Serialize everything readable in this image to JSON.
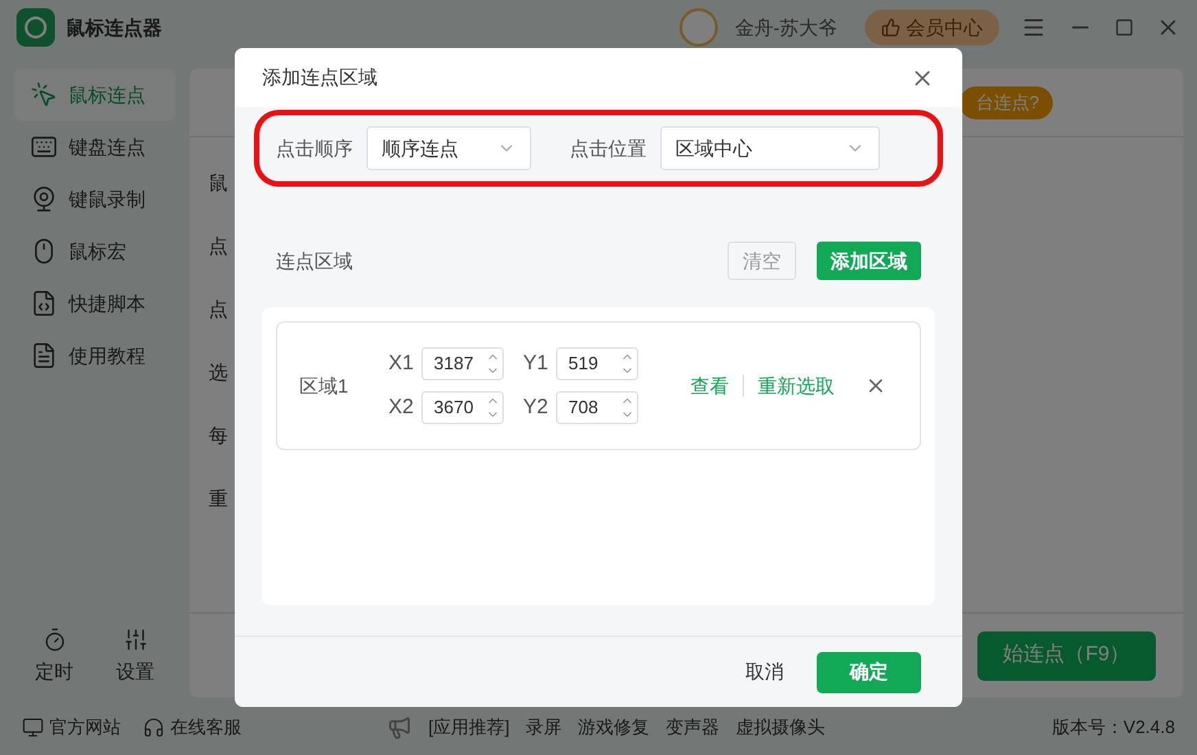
{
  "window": {
    "title": "鼠标连点器",
    "user": "金舟-苏大爷",
    "vip_button": "会员中心"
  },
  "sidebar": {
    "items": [
      {
        "label": "鼠标连点",
        "kind": "cursor",
        "selected": true
      },
      {
        "label": "键盘连点",
        "kind": "keyboard",
        "selected": false
      },
      {
        "label": "键鼠录制",
        "kind": "webcam",
        "selected": false
      },
      {
        "label": "鼠标宏",
        "kind": "mouse",
        "selected": false
      },
      {
        "label": "快捷脚本",
        "kind": "code",
        "selected": false
      },
      {
        "label": "使用教程",
        "kind": "doc",
        "selected": false
      }
    ],
    "bottom": [
      {
        "label": "定时",
        "kind": "timer"
      },
      {
        "label": "设置",
        "kind": "sliders"
      }
    ]
  },
  "background_panel": {
    "badge": "台连点?",
    "labels": [
      "鼠",
      "点",
      "点",
      "选",
      "每",
      "重"
    ],
    "start_button": "始连点（F9）"
  },
  "dialog": {
    "title": "添加连点区域",
    "order_label": "点击顺序",
    "order_value": "顺序连点",
    "position_label": "点击位置",
    "position_value": "区域中心",
    "areas_label": "连点区域",
    "clear_button": "清空",
    "add_button": "添加区域",
    "areas": [
      {
        "name": "区域1",
        "fields": [
          {
            "label": "X1",
            "value": "3187"
          },
          {
            "label": "Y1",
            "value": "519"
          },
          {
            "label": "X2",
            "value": "3670"
          },
          {
            "label": "Y2",
            "value": "708"
          }
        ],
        "view_link": "查看",
        "reselect_link": "重新选取"
      }
    ],
    "cancel_button": "取消",
    "ok_button": "确定"
  },
  "footer": {
    "links": [
      {
        "label": "官方网站",
        "kind": "monitor"
      },
      {
        "label": "在线客服",
        "kind": "headset"
      }
    ],
    "recommend_label": "[应用推荐]",
    "apps": [
      "录屏",
      "游戏修复",
      "变声器",
      "虚拟摄像头"
    ],
    "version": "版本号：V2.4.8"
  }
}
